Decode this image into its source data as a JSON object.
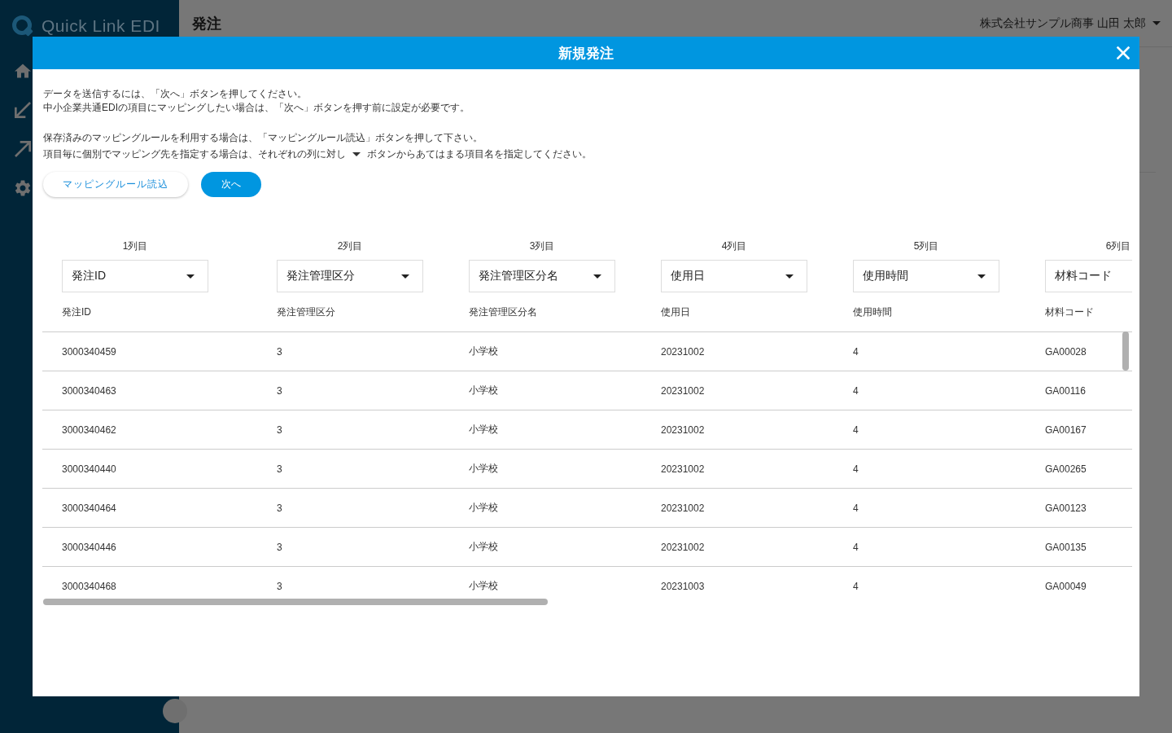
{
  "app": {
    "logo_text": "Quick Link EDI"
  },
  "header": {
    "title": "発注",
    "user": "株式会社サンプル商事 山田 太郎"
  },
  "dialog": {
    "title": "新規発注",
    "instructions": [
      {
        "lines": [
          {
            "kind": "text",
            "text": "データを送信するには、「次へ」ボタンを押してください。"
          },
          {
            "kind": "text",
            "text": "中小企業共通EDIの項目にマッピングしたい場合は、「次へ」ボタンを押す前に設定が必要です。"
          }
        ]
      },
      {
        "lines": [
          {
            "kind": "text",
            "text": "保存済みのマッピングルールを利用する場合は、「マッピングルール読込」ボタンを押して下さい。"
          },
          {
            "kind": "with_caret",
            "before": "項目毎に個別でマッピング先を指定する場合は、それぞれの列に対し",
            "after": "ボタンからあてはまる項目名を指定してください。"
          }
        ]
      }
    ],
    "buttons": [
      {
        "label": "マッピングルール読込",
        "kind": "secondary"
      },
      {
        "label": "次へ",
        "kind": "primary"
      }
    ],
    "table": {
      "columns": [
        {
          "position": "1列目",
          "mapped_to": "発注ID",
          "field": "発注ID"
        },
        {
          "position": "2列目",
          "mapped_to": "発注管理区分",
          "field": "発注管理区分"
        },
        {
          "position": "3列目",
          "mapped_to": "発注管理区分名",
          "field": "発注管理区分名"
        },
        {
          "position": "4列目",
          "mapped_to": "使用日",
          "field": "使用日"
        },
        {
          "position": "5列目",
          "mapped_to": "使用時間",
          "field": "使用時間"
        },
        {
          "position": "6列目",
          "mapped_to": "材料コード",
          "field": "材料コード"
        }
      ],
      "rows": [
        [
          "3000340459",
          "3",
          "小学校",
          "20231002",
          "4",
          "GA00028"
        ],
        [
          "3000340463",
          "3",
          "小学校",
          "20231002",
          "4",
          "GA00116"
        ],
        [
          "3000340462",
          "3",
          "小学校",
          "20231002",
          "4",
          "GA00167"
        ],
        [
          "3000340440",
          "3",
          "小学校",
          "20231002",
          "4",
          "GA00265"
        ],
        [
          "3000340464",
          "3",
          "小学校",
          "20231002",
          "4",
          "GA00123"
        ],
        [
          "3000340446",
          "3",
          "小学校",
          "20231002",
          "4",
          "GA00135"
        ],
        [
          "3000340468",
          "3",
          "小学校",
          "20231003",
          "4",
          "GA00049"
        ]
      ]
    }
  }
}
